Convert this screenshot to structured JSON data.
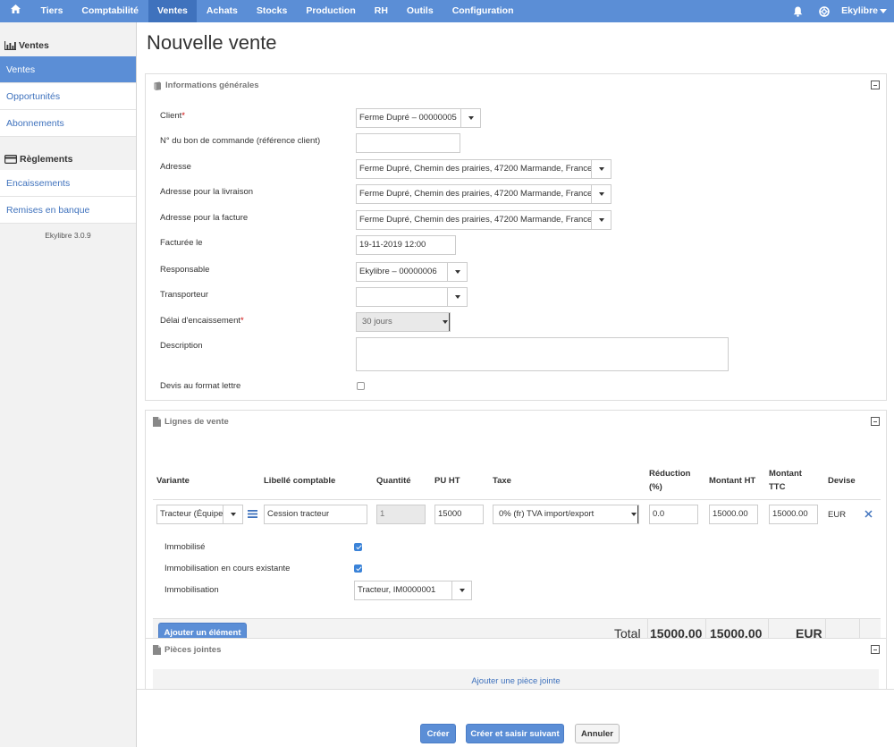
{
  "topnav": {
    "items": [
      "Tiers",
      "Comptabilité",
      "Ventes",
      "Achats",
      "Stocks",
      "Production",
      "RH",
      "Outils",
      "Configuration"
    ],
    "active": "Ventes",
    "user": "Ekylibre"
  },
  "sidebar": {
    "section1": "Ventes",
    "section1_items": [
      "Ventes",
      "Opportunités",
      "Abonnements"
    ],
    "section2": "Règlements",
    "section2_items": [
      "Encaissements",
      "Remises en banque"
    ],
    "version": "Ekylibre 3.0.9"
  },
  "page": {
    "title": "Nouvelle vente"
  },
  "general": {
    "title": "Informations générales",
    "client_label": "Client",
    "client_value": "Ferme Dupré – 00000005",
    "po_label": "N° du bon de commande (référence client)",
    "po_value": "",
    "address_label": "Adresse",
    "address_value": "Ferme Dupré, Chemin des prairies, 47200 Marmande, France",
    "delivery_label": "Adresse pour la livraison",
    "delivery_value": "Ferme Dupré, Chemin des prairies, 47200 Marmande, France",
    "invoice_label": "Adresse pour la facture",
    "invoice_value": "Ferme Dupré, Chemin des prairies, 47200 Marmande, France",
    "invoiced_label": "Facturée le",
    "invoiced_value": "19-11-2019 12:00",
    "responsible_label": "Responsable",
    "responsible_value": "Ekylibre – 00000006",
    "transporter_label": "Transporteur",
    "transporter_value": "",
    "delay_label": "Délai d'encaissement",
    "delay_value": "30 jours",
    "description_label": "Description",
    "letter_label": "Devis au format lettre"
  },
  "lines": {
    "title": "Lignes de vente",
    "headers": {
      "variant": "Variante",
      "label": "Libellé comptable",
      "quantity": "Quantité",
      "unit_price": "PU HT",
      "tax": "Taxe",
      "reduction": "Réduction (%)",
      "amount_ht": "Montant HT",
      "amount_ttc": "Montant TTC",
      "currency": "Devise"
    },
    "row": {
      "variant": "Tracteur (Équipe",
      "label": "Cession tracteur",
      "quantity": "1",
      "unit_price": "15000",
      "tax": "0% (fr) TVA import/export",
      "reduction": "0.0",
      "amount_ht": "15000.00",
      "amount_ttc": "15000.00",
      "currency": "EUR"
    },
    "immobilise_label": "Immobilisé",
    "existing_label": "Immobilisation en cours existante",
    "fixed_asset_label": "Immobilisation",
    "fixed_asset_value": "Tracteur, IM0000001",
    "add_item": "Ajouter un élément",
    "total_label": "Total",
    "total_ht": "15000.00",
    "total_ttc": "15000.00",
    "total_currency": "EUR"
  },
  "attachments": {
    "title": "Pièces jointes",
    "add": "Ajouter une pièce jointe"
  },
  "actions": {
    "create": "Créer",
    "create_next": "Créer et saisir suivant",
    "cancel": "Annuler"
  }
}
